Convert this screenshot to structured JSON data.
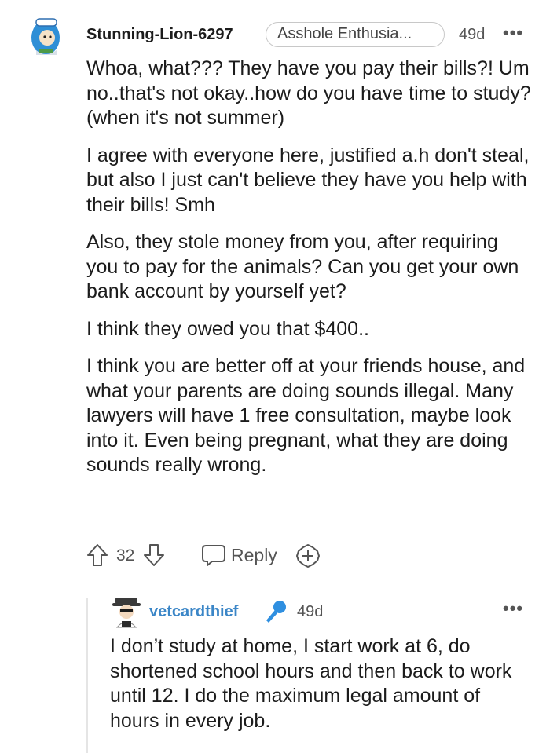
{
  "comment": {
    "username": "Stunning-Lion-6297",
    "flair": "Asshole Enthusia...",
    "time": "49d",
    "more_icon": "more-horizontal-icon",
    "paragraphs": [
      "Whoa, what??? They have you pay their bills?! Um no..that's not okay..how do you have time to study?(when it's not summer)",
      "I agree with everyone here, justified a.h don't steal, but also I just can't believe they have you help with their bills! Smh",
      "Also, they stole money from you, after requiring you to pay for the animals? Can you get your own bank account by yourself yet?",
      "I think they owed you that $400..",
      "I think you are better off at your friends house, and what your parents are doing sounds illegal. Many lawyers will have 1 free consultation, maybe look into it. Even being pregnant, what they are doing sounds really wrong."
    ],
    "votes": "32",
    "reply_label": "Reply",
    "icons": {
      "upvote": "upvote-arrow-icon",
      "downvote": "downvote-arrow-icon",
      "reply": "reply-bubble-icon",
      "award": "award-plus-icon"
    }
  },
  "reply": {
    "username": "vetcardthief",
    "time": "49d",
    "text": "I don’t study at home, I start work at 6, do shortened school hours and then back to work until 12. I do the maximum legal amount of hours in every job.",
    "username_color": "#3b86c7",
    "badge_icon": "microphone-icon"
  }
}
